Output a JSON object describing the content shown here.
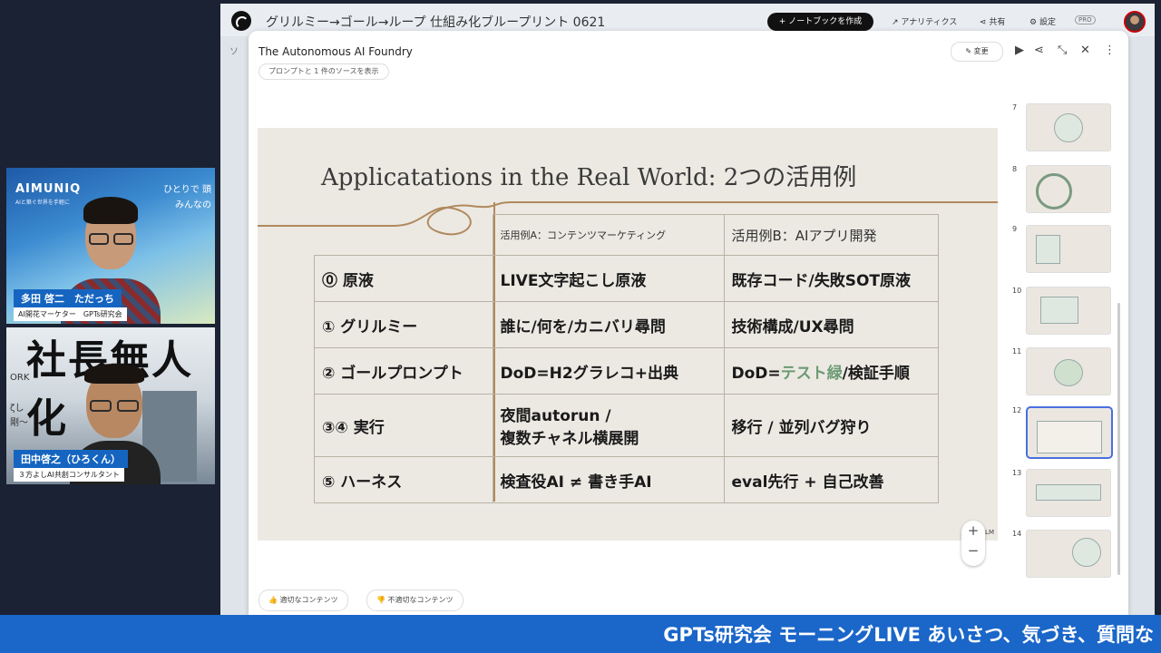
{
  "webcam1": {
    "brand": "AIMUNIQ",
    "brand_sub": "AIと築ぐ世界を手軽に",
    "slogan": "ひとりで 頭\nみんなの",
    "name": "多田 啓二　ただっち",
    "role": "AI開花マーケター　GPTs研究会"
  },
  "webcam2": {
    "bg_text": "社長無人化",
    "side_text_1": "ORK",
    "side_text_2": "ζし",
    "side_text_3": "剛～",
    "name": "田中啓之（ひろくん）",
    "role": "３方よしAI共創コンサルタント"
  },
  "topbar": {
    "notebook_title": "グリルミー→ゴール→ループ 仕組み化ブループリント 0621",
    "create_label": "+ ノートブックを作成",
    "analytics_label": "アナリティクス",
    "share_label": "共有",
    "settings_label": "設定",
    "pro_label": "PRO"
  },
  "panel": {
    "title": "The Autonomous AI Foundry",
    "sources_chip": "プロンプトと 1 件のソースを表示",
    "edit_label": "変更"
  },
  "slide": {
    "title": "Applicatations in the Real World: 2つの活用例",
    "header_a": "活用例A：コンテンツマーケティング",
    "header_b": "活用例B：AIアプリ開発",
    "rows": [
      {
        "label": "⓪ 原液",
        "a": "LIVE文字起こし原液",
        "b": "既存コード/失敗SOT原液"
      },
      {
        "label": "① グリルミー",
        "a": "誰に/何を/カニバリ尋問",
        "b": "技術構成/UX尋問"
      },
      {
        "label": "② ゴールプロンプト",
        "a": "DoD=H2グラレコ+出典",
        "b_pre": "DoD=",
        "b_green": "テスト緑",
        "b_post": "/検証手順"
      },
      {
        "label": "③④ 実行",
        "a": "夜間autorun /\n複数チャネル横展開",
        "b": "移行 / 並列バグ狩り"
      },
      {
        "label": "⑤ ハーネス",
        "a": "検査役AI ≠ 書き手AI",
        "b": "eval先行 + 自己改善"
      }
    ],
    "watermark": "Ｎо LM",
    "accent_green": "#6b9a73"
  },
  "thumbnails": [
    {
      "num": "7"
    },
    {
      "num": "8"
    },
    {
      "num": "9"
    },
    {
      "num": "10"
    },
    {
      "num": "11"
    },
    {
      "num": "12",
      "selected": true
    },
    {
      "num": "13"
    },
    {
      "num": "14"
    }
  ],
  "feedback": {
    "good": "適切なコンテンツ",
    "bad": "不適切なコンテンツ"
  },
  "zoom": {
    "plus": "+",
    "minus": "−"
  },
  "banner": {
    "text": "GPTs研究会 モーニングLIVE あいさつ、気づき、質問な",
    "color": "#1a66c9"
  }
}
